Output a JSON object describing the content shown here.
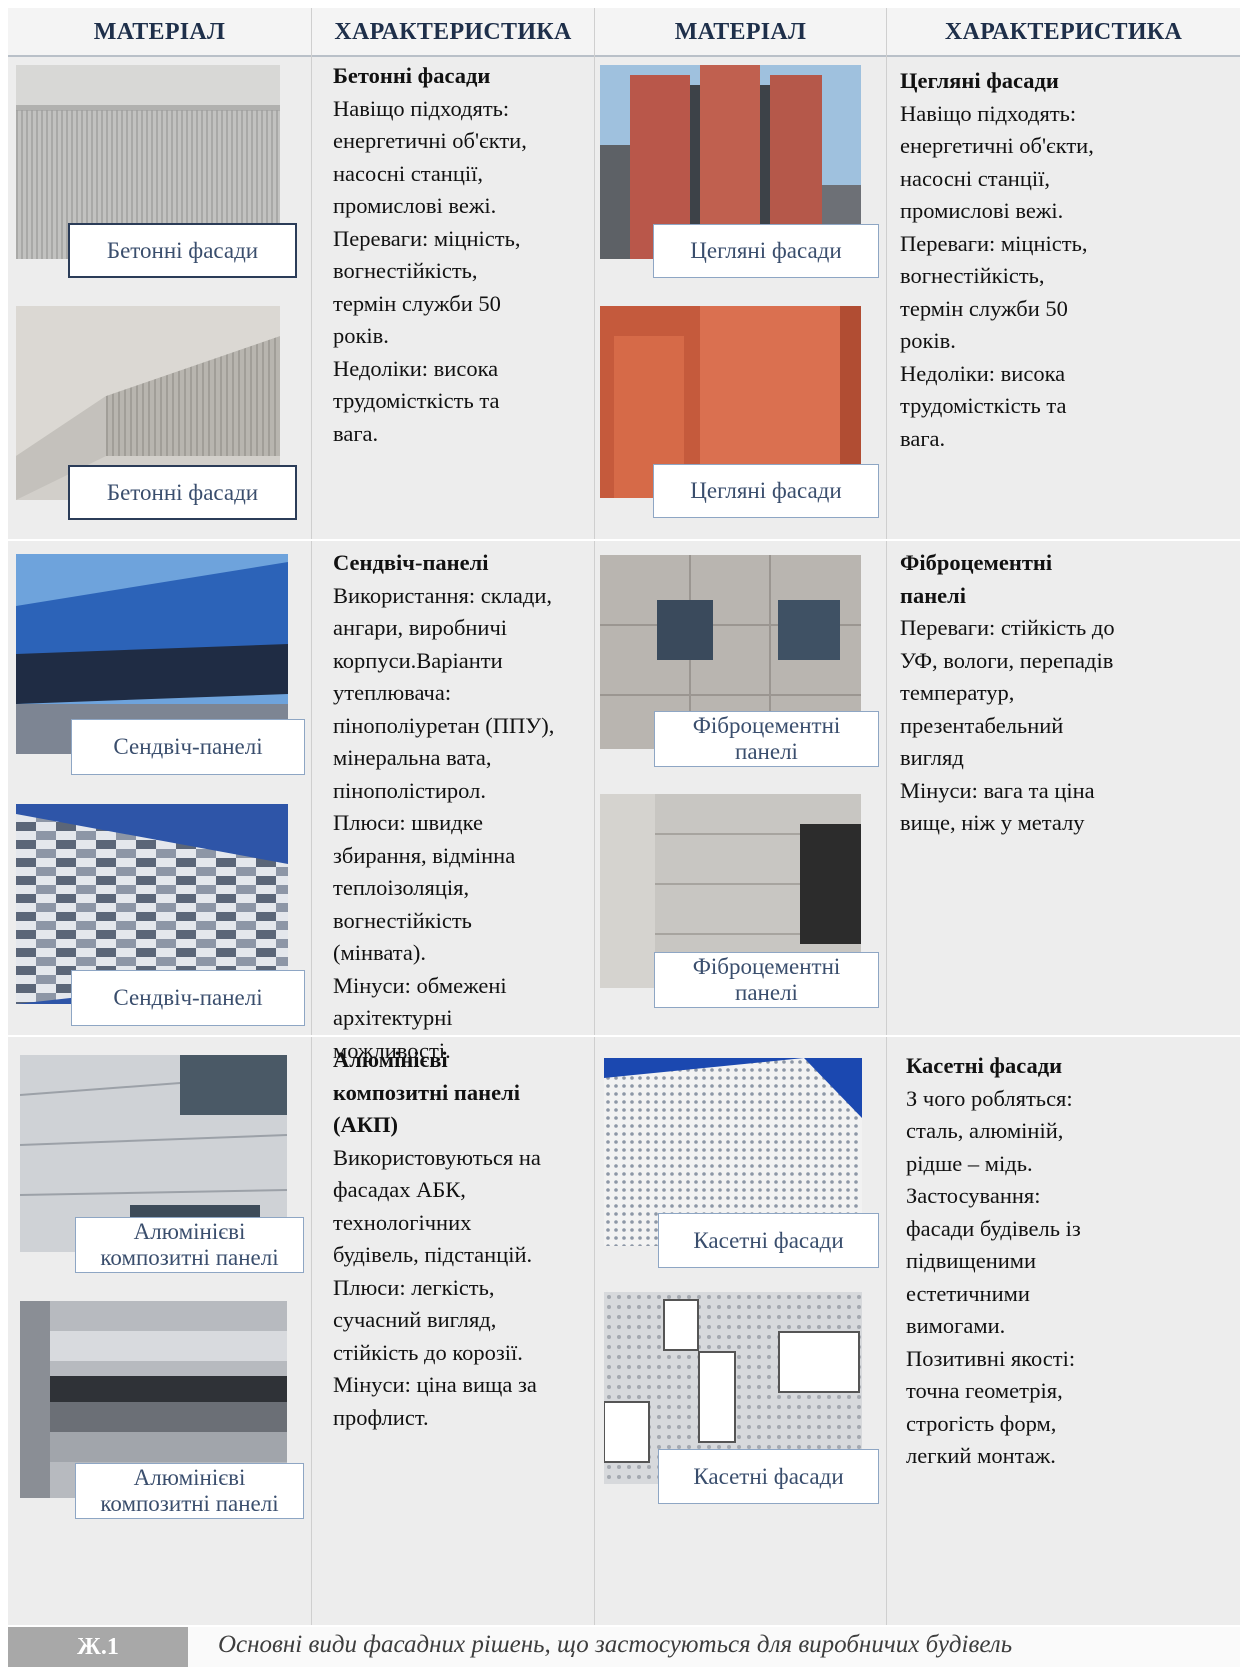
{
  "headers": [
    "МАТЕРІАЛ",
    "ХАРАКТЕРИСТИКА",
    "МАТЕРІАЛ",
    "ХАРАКТЕРИСТИКА"
  ],
  "materials": [
    {
      "photos": [
        "Бетонні фасади",
        "Бетонні фасади"
      ],
      "title": "Бетонні фасади",
      "body": "Навіщо підходять:\nенергетичні об'єкти,\nнасосні станції,\nпромислові вежі.\nПереваги: міцність,\nвогнестійкість,\nтермін служби 50\nроків.\nНедоліки: висока\nтрудомісткість та\nвага."
    },
    {
      "photos": [
        "Цегляні фасади",
        "Цегляні фасади"
      ],
      "title": "Цегляні фасади",
      "body": "Навіщо підходять:\nенергетичні об'єкти,\nнасосні станції,\nпромислові вежі.\nПереваги: міцність,\nвогнестійкість,\nтермін служби 50\nроків.\nНедоліки: висока\nтрудомісткість та\nвага."
    },
    {
      "photos": [
        "Сендвіч-панелі",
        "Сендвіч-панелі"
      ],
      "title": "Сендвіч-панелі",
      "body": "Використання: склади,\nангари, виробничі\nкорпуси.Варіанти\nутеплювача:\nпінополіуретан (ППУ),\nмінеральна вата,\nпінополістирол.\nПлюси: швидке\nзбирання, відмінна\nтеплоізоляція,\nвогнестійкість\n(мінвата).\nМінуси: обмежені\nархітектурні\nможливості."
    },
    {
      "photos": [
        "Фіброцементні\nпанелі",
        "Фіброцементні\nпанелі"
      ],
      "title": "Фіброцементні\nпанелі",
      "body": "Переваги: стійкість до\nУФ, вологи, перепадів\nтемператур,\nпрезентабельний\nвигляд\nМінуси: вага та ціна\nвище, ніж у металу"
    },
    {
      "photos": [
        "Алюмінієві\nкомпозитні панелі",
        "Алюмінієві\nкомпозитні панелі"
      ],
      "title": "Алюмінієві\nкомпозитні панелі\n(АКП)",
      "body": "Використовуються на\nфасадах АБК,\nтехнологічних\nбудівель, підстанцій.\nПлюси: легкість,\nсучасний вигляд,\nстійкість до корозії.\nМінуси: ціна вища за\nпрофлист."
    },
    {
      "photos": [
        "Касетні фасади",
        "Касетні фасади"
      ],
      "title": "Касетні фасади",
      "body": "З чого робляться:\nсталь, алюміній,\nрідше – мідь.\nЗастосування:\nфасади будівель із\nпідвищеними\nестетичними\nвимогами.\nПозитивні якості:\nточна геометрія,\nстрогість форм,\nлегкий монтаж."
    }
  ],
  "footer": {
    "figure_id": "Ж.1",
    "caption": "Основні види фасадних рішень, що застосуються для виробничих будівель"
  }
}
